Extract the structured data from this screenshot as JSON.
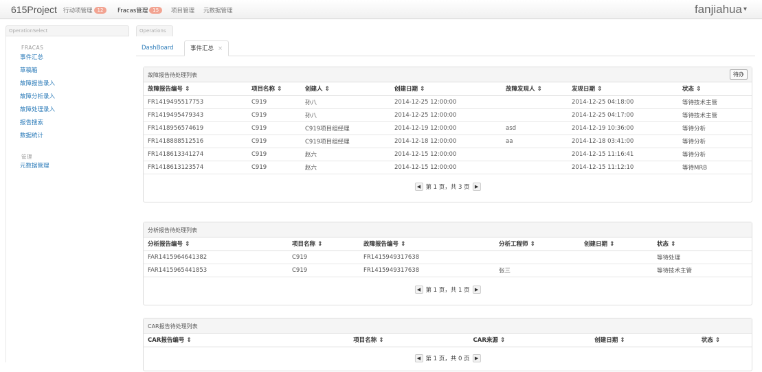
{
  "navbar": {
    "brand": "615Project",
    "items": [
      {
        "label": "行动项管理",
        "badge": "12"
      },
      {
        "label": "Fracas管理",
        "badge": "15"
      },
      {
        "label": "项目管理",
        "badge": ""
      },
      {
        "label": "元数据管理",
        "badge": ""
      }
    ],
    "user": "fanjiahua"
  },
  "sidebar": {
    "header": "OperationSelect",
    "category1": "FRACAS",
    "links1": [
      "事件汇总",
      "草稿箱",
      "故障报告录入",
      "故障分析录入",
      "故障处理录入",
      "报告搜索",
      "数据统计"
    ],
    "category2": "管理",
    "links2": [
      "元数据管理"
    ]
  },
  "main": {
    "header": "Operations",
    "tabs": [
      {
        "label": "DashBoard"
      },
      {
        "label": "事件汇总",
        "close": "×"
      }
    ]
  },
  "fault_panel": {
    "title": "故障报告待处理列表",
    "button": "待办",
    "columns": [
      "故障报告编号",
      "项目名称",
      "创建人",
      "创建日期",
      "故障发现人",
      "发现日期",
      "状态"
    ],
    "rows": [
      [
        "FR1419495517753",
        "C919",
        "孙八",
        "2014-12-25 12:00:00",
        "",
        "2014-12-25 04:18:00",
        "等待技术主管"
      ],
      [
        "FR1419495479343",
        "C919",
        "孙八",
        "2014-12-25 12:00:00",
        "",
        "2014-12-25 04:17:00",
        "等待技术主管"
      ],
      [
        "FR1418956574619",
        "C919",
        "C919项目组经理",
        "2014-12-19 12:00:00",
        "asd",
        "2014-12-19 10:36:00",
        "等待分析"
      ],
      [
        "FR1418888512516",
        "C919",
        "C919项目组经理",
        "2014-12-18 12:00:00",
        "aa",
        "2014-12-18 03:41:00",
        "等待分析"
      ],
      [
        "FR1418613341274",
        "C919",
        "赵六",
        "2014-12-15 12:00:00",
        "",
        "2014-12-15 11:16:41",
        "等待分析"
      ],
      [
        "FR1418613123574",
        "C919",
        "赵六",
        "2014-12-15 12:00:00",
        "",
        "2014-12-15 11:12:10",
        "等待MRB"
      ]
    ],
    "pager": "第 1 页，共 3 页"
  },
  "analysis_panel": {
    "title": "分析报告待处理列表",
    "columns": [
      "分析报告编号",
      "项目名称",
      "故障报告编号",
      "分析工程师",
      "创建日期",
      "状态"
    ],
    "rows": [
      [
        "FAR1415964641382",
        "C919",
        "FR1415949317638",
        "",
        "",
        "等待处理"
      ],
      [
        "FAR1415965441853",
        "C919",
        "FR1415949317638",
        "张三",
        "",
        "等待技术主管"
      ]
    ],
    "pager": "第 1 页，共 1 页"
  },
  "car_panel": {
    "title": "CAR报告待处理列表",
    "columns": [
      "CAR报告编号",
      "项目名称",
      "CAR来源",
      "创建日期",
      "状态"
    ],
    "pager": "第 1 页，共 0 页"
  }
}
